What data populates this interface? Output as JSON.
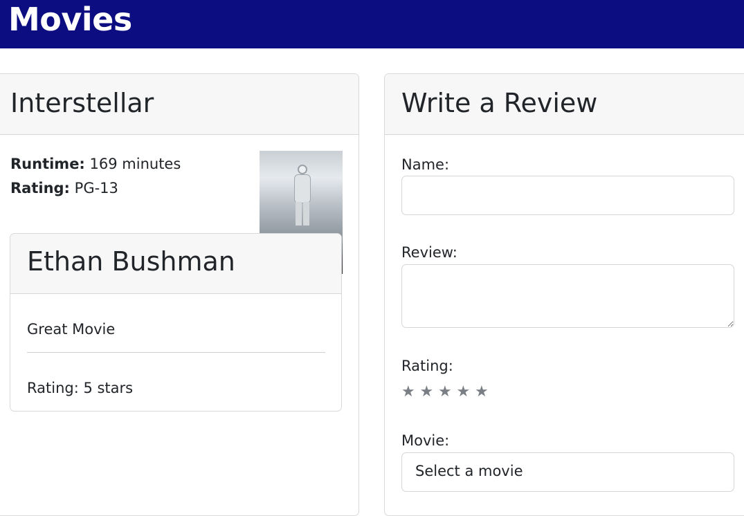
{
  "navbar": {
    "brand": "Movies"
  },
  "movie": {
    "title": "Interstellar",
    "runtime_label": "Runtime:",
    "runtime_value": "169 minutes",
    "rating_label": "Rating:",
    "rating_value": "PG-13"
  },
  "review": {
    "author": "Ethan Bushman",
    "text": "Great Movie",
    "rating_text": "Rating: 5 stars"
  },
  "form": {
    "title": "Write a Review",
    "name_label": "Name:",
    "name_value": "",
    "review_label": "Review:",
    "review_value": "",
    "rating_label": "Rating:",
    "stars": [
      "★",
      "★",
      "★",
      "★",
      "★"
    ],
    "movie_label": "Movie:",
    "movie_selected": "Select a movie"
  },
  "colors": {
    "navbar": "#0c0d80",
    "card_header": "#f7f7f7",
    "star": "#7a7f85"
  }
}
